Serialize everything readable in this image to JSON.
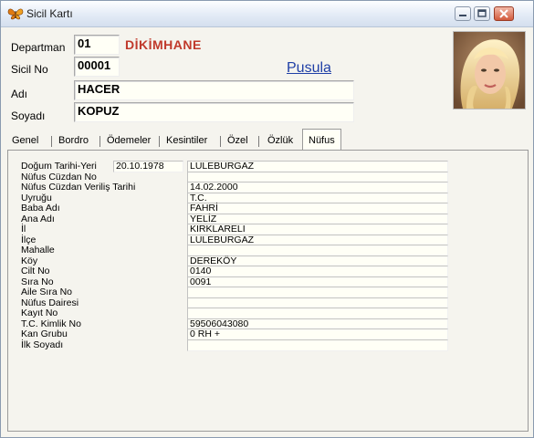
{
  "window": {
    "title": "Sicil Kartı",
    "icon": "butterfly-icon",
    "buttons": [
      "minimize-icon",
      "maximize-icon",
      "close-icon"
    ]
  },
  "header": {
    "departman_label": "Departman",
    "departman_code": "01",
    "departman_name": "DİKİMHANE",
    "sicil_label": "Sicil No",
    "sicil_no": "00001",
    "pusula": "Pusula",
    "adi_label": "Adı",
    "adi": "HACER",
    "soyadi_label": "Soyadı",
    "soyadi": "KOPUZ"
  },
  "tabs": [
    {
      "label": "Genel"
    },
    {
      "label": "Bordro"
    },
    {
      "label": "Ödemeler"
    },
    {
      "label": "Kesintiler"
    },
    {
      "label": "Özel"
    },
    {
      "label": "Özlük"
    },
    {
      "label": "Nüfus"
    }
  ],
  "active_tab": "Nüfus",
  "nufus": {
    "dogum_label": "Doğum Tarihi-Yeri",
    "dogum_tarihi": "20.10.1978",
    "dogum_yeri": "LULEBURGAZ",
    "rows": [
      {
        "label": "Nüfus Cüzdan No",
        "value": ""
      },
      {
        "label": "Nüfus Cüzdan Veriliş Tarihi",
        "value": "14.02.2000"
      },
      {
        "label": "Uyruğu",
        "value": "T.C."
      },
      {
        "label": "Baba Adı",
        "value": "FAHRİ"
      },
      {
        "label": "Ana Adı",
        "value": "YELİZ"
      },
      {
        "label": "İl",
        "value": "KIRKLARELI"
      },
      {
        "label": "İlçe",
        "value": "LULEBURGAZ"
      },
      {
        "label": "Mahalle",
        "value": ""
      },
      {
        "label": "Köy",
        "value": "DEREKÖY"
      },
      {
        "label": "Cilt No",
        "value": "0140"
      },
      {
        "label": "Sıra No",
        "value": "0091"
      },
      {
        "label": "Aile Sıra No",
        "value": ""
      },
      {
        "label": "Nüfus Dairesi",
        "value": ""
      },
      {
        "label": "Kayıt No",
        "value": ""
      },
      {
        "label": "T.C. Kimlik No",
        "value": "59506043080"
      },
      {
        "label": "Kan Grubu",
        "value": "0 RH +"
      },
      {
        "label": "İlk Soyadı",
        "value": ""
      }
    ]
  }
}
